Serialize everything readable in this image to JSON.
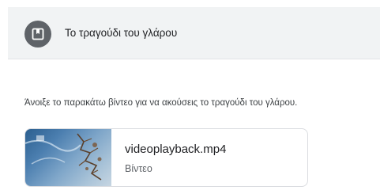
{
  "header": {
    "icon": "bookmark-icon",
    "title": "Το τραγούδι του γλάρου"
  },
  "body": {
    "description": "Άνοιξε το παρακάτω βίντεο για να ακούσεις το τραγούδι του γλάρου."
  },
  "attachment": {
    "file_name": "videoplayback.mp4",
    "file_type": "Βίντεο",
    "thumbnail": "video-thumbnail"
  },
  "colors": {
    "header_bg": "#f1f3f4",
    "icon_circle": "#5f6368",
    "card_border": "#dadce0"
  }
}
